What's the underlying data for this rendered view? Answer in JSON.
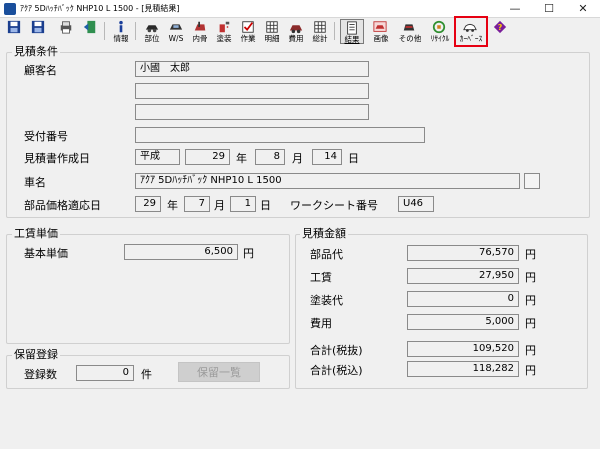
{
  "window": {
    "title": "ｱｸｱ 5Dﾊｯﾁﾊﾞｯｸ NHP10 L    1500 - [見積結果]",
    "minimize": "—",
    "maximize": "☐",
    "close": "✕"
  },
  "toolbar": {
    "jouhou": "情報",
    "buhin": "部位",
    "ws": "W/S",
    "naiyou": "内骨",
    "tosou": "塗装",
    "sakujo": "作業",
    "meisai": "明細",
    "hiyou": "費用",
    "soukei": "総計",
    "kekka": "結果",
    "gamen": "画像",
    "sonota": "その他",
    "recycle": "ﾘｻｲｸﾙ",
    "ddbase": "ｶｰﾍﾞｰｽ",
    "highlight_color": "#e60012"
  },
  "estimate": {
    "group_title": "見積条件",
    "customer_label": "顧客名",
    "customer_value": "小國　太郎",
    "customer_line2": "",
    "customer_line3": "",
    "receipt_label": "受付番号",
    "receipt_value": "",
    "created_label": "見積書作成日",
    "era": "平成",
    "year": "29",
    "year_unit": "年",
    "month": "8",
    "month_unit": "月",
    "day": "14",
    "day_unit": "日",
    "car_label": "車名",
    "car_value": "ｱｸｱ 5Dﾊｯﾁﾊﾞｯｸ NHP10 L    1500",
    "price_date_label": "部品価格適応日",
    "price_year": "29",
    "price_year_unit": "年",
    "price_month": "7",
    "price_month_unit": "月",
    "price_day": "1",
    "price_day_unit": "日",
    "worksheet_label": "ワークシート番号",
    "worksheet_value": "U46"
  },
  "labor": {
    "group_title": "工賃単価",
    "base_label": "基本単価",
    "base_value": "6,500",
    "base_unit": "円"
  },
  "hold": {
    "group_title": "保留登録",
    "count_label": "登録数",
    "count_value": "0",
    "count_unit": "件",
    "list_button": "保留一覧"
  },
  "amount": {
    "group_title": "見積金額",
    "rows": [
      {
        "label": "部品代",
        "value": "76,570",
        "unit": "円"
      },
      {
        "label": "工賃",
        "value": "27,950",
        "unit": "円"
      },
      {
        "label": "塗装代",
        "value": "0",
        "unit": "円"
      },
      {
        "label": "費用",
        "value": "5,000",
        "unit": "円"
      },
      {
        "label": "合計(税抜)",
        "value": "109,520",
        "unit": "円"
      },
      {
        "label": "合計(税込)",
        "value": "118,282",
        "unit": "円"
      }
    ]
  }
}
